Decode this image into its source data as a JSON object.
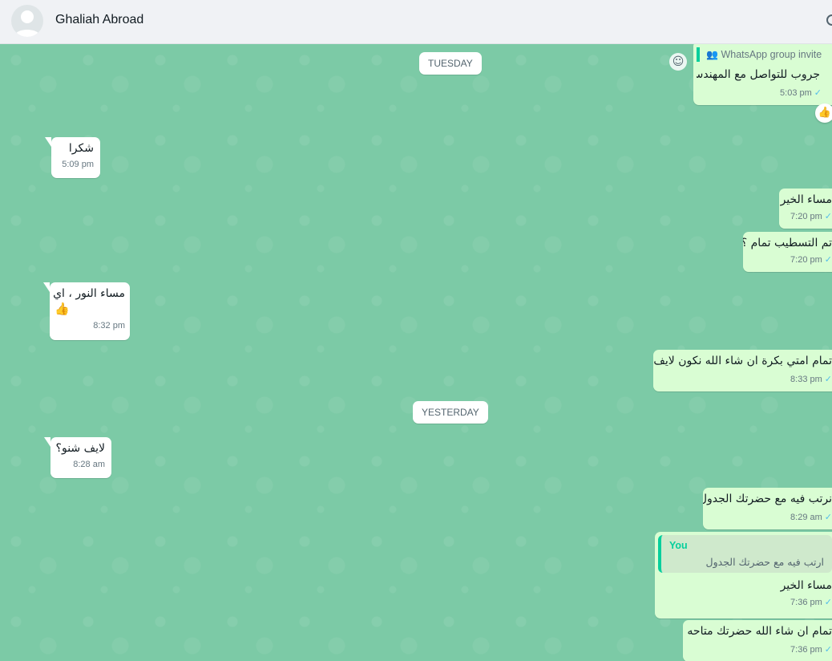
{
  "header": {
    "contact_name": "Ghaliah Abroad"
  },
  "dates": {
    "tuesday": "TUESDAY",
    "yesterday": "YESTERDAY"
  },
  "messages": [
    {
      "dir": "out",
      "invite_label": "WhatsApp group invite",
      "text": "جروب للتواصل مع المهندس",
      "time": "5:03 pm",
      "reaction": "👍"
    },
    {
      "dir": "in",
      "text": "شكرا",
      "time": "5:09 pm"
    },
    {
      "dir": "out",
      "text": "مساء الخير",
      "time": "7:20 pm"
    },
    {
      "dir": "out",
      "text": "تم التسطيب تمام ؟",
      "time": "7:20 pm"
    },
    {
      "dir": "in",
      "text": "مساء النور ، اي",
      "emoji": "👍",
      "time": "8:32 pm"
    },
    {
      "dir": "out",
      "text": "تمام امتي بكرة ان شاء الله نكون لايف ؟",
      "time": "8:33 pm"
    },
    {
      "dir": "in",
      "text": "لايف شنو؟",
      "time": "8:28 am"
    },
    {
      "dir": "out",
      "text": "نرتب فيه مع حضرتك الجدول",
      "time": "8:29 am"
    },
    {
      "dir": "out",
      "reply_author": "You",
      "reply_text": "ارتب فيه مع حضرتك الجدول",
      "text": "مساء الخير",
      "time": "7:36 pm"
    },
    {
      "dir": "out",
      "text": "تمام  ان شاء الله حضرتك متاحه ؟",
      "time": "7:36 pm"
    }
  ],
  "colors": {
    "chat_bg": "#7ccaa6",
    "outgoing_bubble": "#d9fdd3",
    "incoming_bubble": "#ffffff",
    "accent": "#06cf9c",
    "read_tick": "#53bdeb"
  },
  "icons": {
    "avatar": "person-silhouette-icon",
    "search": "search-icon",
    "emoji": "smiley-icon",
    "group": "group-icon",
    "tick": "double-check-icon"
  }
}
